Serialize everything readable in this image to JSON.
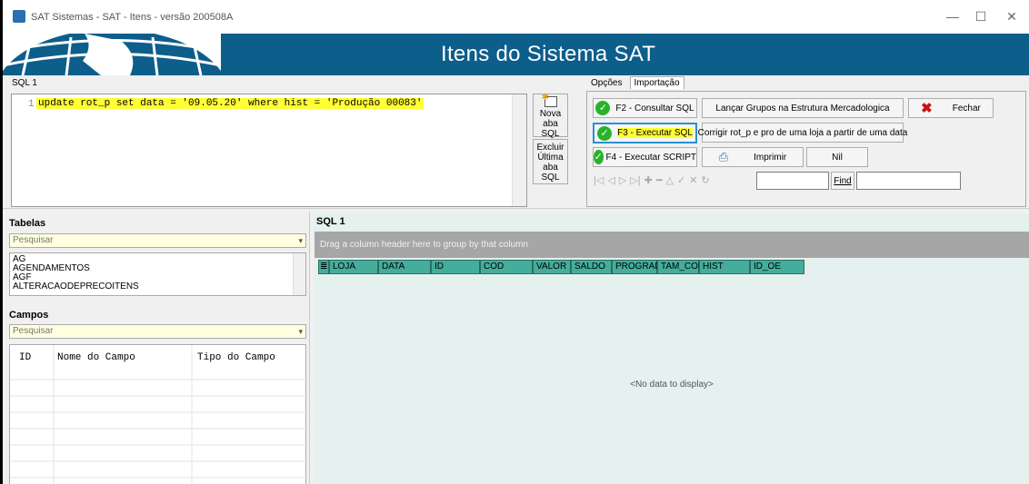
{
  "window": {
    "title": "SAT Sistemas - SAT - Itens - versão 200508A",
    "minimize": "—",
    "maximize": "☐",
    "close": "✕"
  },
  "banner": {
    "title": "Itens do Sistema SAT"
  },
  "sql_editor": {
    "tab_label": "SQL 1",
    "line_number": "1",
    "code": "update rot_p set data = '09.05.20' where hist = 'Produção 00083'",
    "new_tab_label": "Nova aba SQL",
    "delete_tab_label": "Excluir Última aba SQL"
  },
  "options": {
    "tabs": [
      "Opções",
      "Importação"
    ],
    "consult_sql": "F2 - Consultar SQL",
    "execute_sql": "F3 - Executar SQL",
    "execute_script": "F4 - Executar SCRIPT",
    "launch_groups": "Lançar Grupos na Estrutura Mercadologica",
    "fix_rot": "Corrigir rot_p e pro de uma loja a partir de uma data",
    "print": "Imprimir",
    "nil": "Nil",
    "close": "Fechar",
    "find": "Find"
  },
  "tables": {
    "label": "Tabelas",
    "search_placeholder": "Pesquisar",
    "items": [
      "AG",
      "AGENDAMENTOS",
      "AGF",
      "ALTERACAODEPRECOITENS"
    ]
  },
  "fields": {
    "label": "Campos",
    "search_placeholder": "Pesquisar",
    "columns": [
      "ID",
      "Nome do Campo",
      "Tipo do Campo"
    ]
  },
  "result": {
    "tab_label": "SQL 1",
    "group_hint": "Drag a column header here to group by that column",
    "columns": [
      "LOJA",
      "DATA",
      "ID",
      "COD",
      "VALOR",
      "SALDO",
      "PROGRADE",
      "TAM_COR",
      "HIST",
      "ID_OE"
    ],
    "empty_text": "<No data to display>"
  },
  "colors": {
    "banner": "#0d5e8a",
    "highlight": "#ffff33",
    "column_header": "#44ad9c",
    "grid_background": "#e4f1ef",
    "group_bar": "#a6a6a6"
  }
}
